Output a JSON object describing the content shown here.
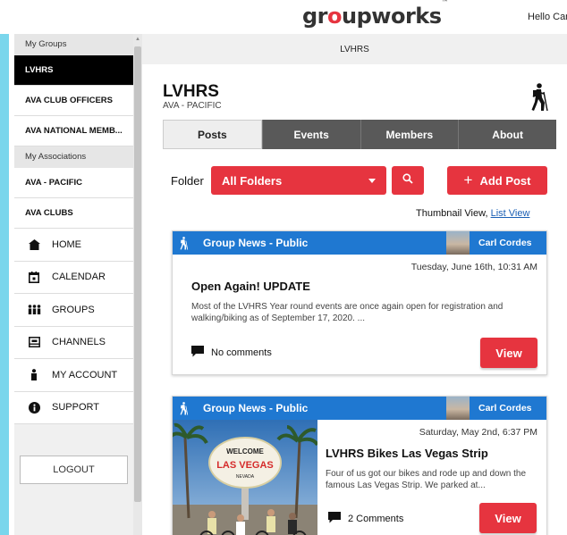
{
  "header": {
    "logo_pre": "gr",
    "logo_o": "o",
    "logo_post": "upworks",
    "logo_tm": "™",
    "greeting": "Hello Car"
  },
  "sidebar": {
    "my_groups_heading": "My Groups",
    "groups": [
      "LVHRS",
      "AVA CLUB OFFICERS",
      "AVA NATIONAL MEMB..."
    ],
    "my_associations_heading": "My Associations",
    "associations": [
      "AVA - PACIFIC",
      "AVA CLUBS"
    ],
    "nav": [
      {
        "label": "HOME",
        "icon": "home-icon"
      },
      {
        "label": "CALENDAR",
        "icon": "calendar-icon"
      },
      {
        "label": "GROUPS",
        "icon": "groups-icon"
      },
      {
        "label": "CHANNELS",
        "icon": "channels-icon"
      },
      {
        "label": "MY ACCOUNT",
        "icon": "account-icon"
      },
      {
        "label": "SUPPORT",
        "icon": "info-icon"
      }
    ],
    "logout_label": "LOGOUT"
  },
  "breadcrumb": "LVHRS",
  "group": {
    "title": "LVHRS",
    "subtitle": "AVA - PACIFIC"
  },
  "tabs": [
    "Posts",
    "Events",
    "Members",
    "About"
  ],
  "toolbar": {
    "folder_label": "Folder",
    "folder_selected": "All Folders",
    "add_post_label": "Add Post",
    "add_post_plus": "+"
  },
  "view_mode": {
    "current": "Thumbnail View,",
    "alternate": "List View"
  },
  "posts": [
    {
      "category": "Group News - Public",
      "author": "Carl Cordes",
      "date": "Tuesday, June 16th, 10:31 AM",
      "title": "Open Again! UPDATE",
      "excerpt": "Most of the LVHRS Year round events are once again open for registration and walking/biking as of September 17, 2020. ...",
      "comments": "No comments",
      "view_label": "View"
    },
    {
      "category": "Group News - Public",
      "author": "Carl Cordes",
      "date": "Saturday, May 2nd, 6:37 PM",
      "title": "LVHRS Bikes Las Vegas Strip",
      "excerpt": "Four of us got our bikes and rode up and down the famous Las Vegas Strip. We parked at...",
      "comments": "2 Comments",
      "view_label": "View",
      "photo_sign_top": "WELCOME",
      "photo_sign_mid": "LAS VEGAS",
      "photo_sign_bottom": "NEVADA"
    }
  ],
  "colors": {
    "accent_red": "#e6343f",
    "header_blue": "#1f78d1",
    "tab_dark": "#595959",
    "side_accent": "#7ad6ec"
  }
}
